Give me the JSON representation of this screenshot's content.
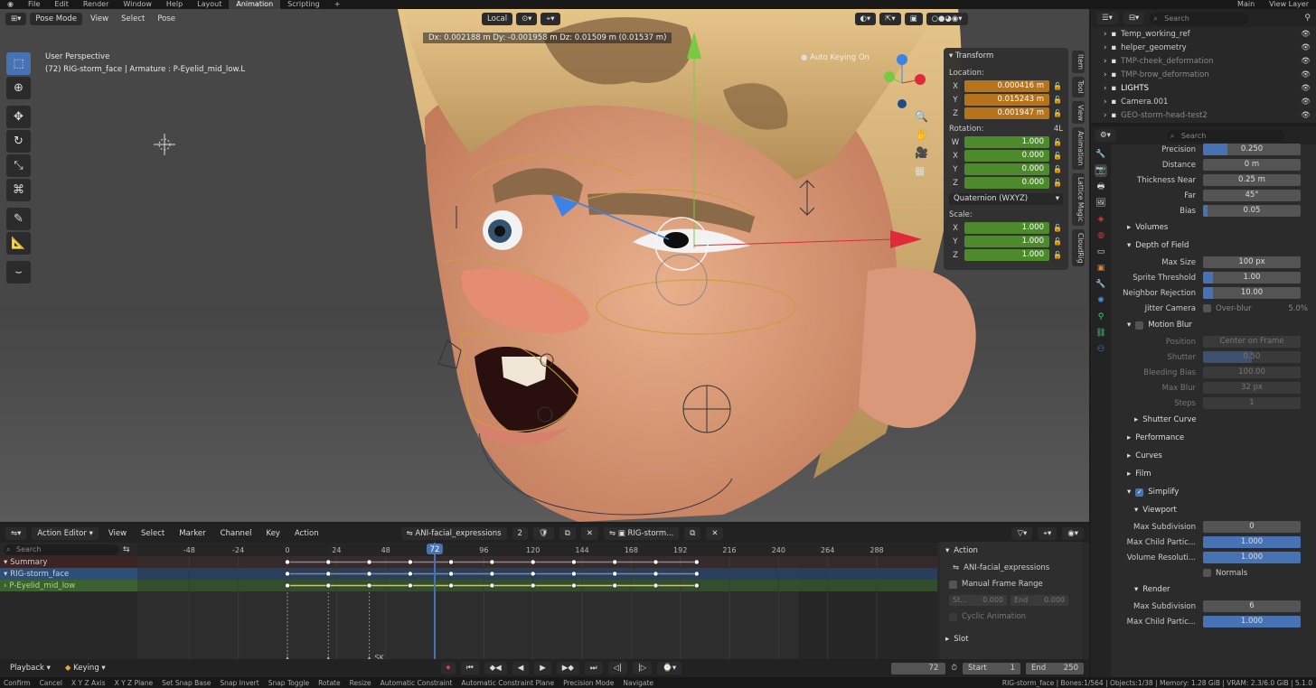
{
  "topbar": {
    "menus": [
      "File",
      "Edit",
      "Render",
      "Window",
      "Help"
    ],
    "workspaces": [
      "Layout",
      "Animation",
      "Scripting"
    ],
    "active_workspace": "Animation",
    "scene": "Main",
    "view_layer": "View Layer"
  },
  "viewport": {
    "mode": "Pose Mode",
    "menus": [
      "View",
      "Select",
      "Pose"
    ],
    "transform_orientation": "Local",
    "perspective": "User Perspective",
    "object_info": "(72) RIG-storm_face | Armature : P-Eyelid_mid_low.L",
    "delta_readout": "Dx: 0.002188 m   Dy: -0.001958 m   Dz: 0.01509 m (0.01537 m)",
    "auto_keying": "Auto Keying On"
  },
  "npanel": {
    "title": "Transform",
    "location_label": "Location:",
    "location": [
      {
        "axis": "X",
        "value": "0.000416 m"
      },
      {
        "axis": "Y",
        "value": "0.015243 m"
      },
      {
        "axis": "Z",
        "value": "0.001947 m"
      }
    ],
    "rotation_label": "Rotation:",
    "rotation_mode_short": "4L",
    "rotation": [
      {
        "axis": "W",
        "value": "1.000"
      },
      {
        "axis": "X",
        "value": "0.000"
      },
      {
        "axis": "Y",
        "value": "0.000"
      },
      {
        "axis": "Z",
        "value": "0.000"
      }
    ],
    "rotation_mode": "Quaternion (WXYZ)",
    "scale_label": "Scale:",
    "scale": [
      {
        "axis": "X",
        "value": "1.000"
      },
      {
        "axis": "Y",
        "value": "1.000"
      },
      {
        "axis": "Z",
        "value": "1.000"
      }
    ],
    "tabs": [
      "Item",
      "Tool",
      "View",
      "Animation",
      "Lattice Magic",
      "CloudRig"
    ]
  },
  "outliner": {
    "search_placeholder": "Search",
    "rows": [
      {
        "name": "Temp_working_ref",
        "color": "#cccccc"
      },
      {
        "name": "helper_geometry",
        "color": "#cccccc"
      },
      {
        "name": "TMP-cheek_deformation",
        "color": "#8a8a8a"
      },
      {
        "name": "TMP-brow_deformation",
        "color": "#8a8a8a"
      },
      {
        "name": "LIGHTS",
        "color": "#ffffff"
      },
      {
        "name": "Camera.001",
        "color": "#cccccc"
      },
      {
        "name": "GEO-storm-head-test2",
        "color": "#8a8a8a"
      }
    ]
  },
  "properties": {
    "search_placeholder": "Search",
    "rows": [
      {
        "kind": "field",
        "label": "Precision",
        "value": "0.250",
        "fill": 0.25
      },
      {
        "kind": "field",
        "label": "Distance",
        "value": "0 m"
      },
      {
        "kind": "field",
        "label": "Thickness Near",
        "value": "0.25 m"
      },
      {
        "kind": "field",
        "label": "Far",
        "value": "45°"
      },
      {
        "kind": "field",
        "label": "Bias",
        "value": "0.05",
        "fill": 0.05
      },
      {
        "kind": "section",
        "label": "Volumes",
        "open": false
      },
      {
        "kind": "section",
        "label": "Depth of Field",
        "open": true
      },
      {
        "kind": "field",
        "label": "Max Size",
        "value": "100 px"
      },
      {
        "kind": "field",
        "label": "Sprite Threshold",
        "value": "1.00",
        "fill": 0.1
      },
      {
        "kind": "field",
        "label": "Neighbor Rejection",
        "value": "10.00",
        "fill": 0.1
      },
      {
        "kind": "check",
        "label": "Jitter Camera",
        "value": "Over-blur",
        "extra": "5.0%"
      },
      {
        "kind": "section",
        "label": "Motion Blur",
        "open": true,
        "checkbox": true
      },
      {
        "kind": "field",
        "label": "Position",
        "value": "Center on Frame",
        "disabled": true
      },
      {
        "kind": "field",
        "label": "Shutter",
        "value": "0.50",
        "disabled": true,
        "fill": 0.5
      },
      {
        "kind": "field",
        "label": "Bleeding Bias",
        "value": "100.00",
        "disabled": true
      },
      {
        "kind": "field",
        "label": "Max Blur",
        "value": "32 px",
        "disabled": true
      },
      {
        "kind": "field",
        "label": "Steps",
        "value": "1",
        "disabled": true
      },
      {
        "kind": "subsection",
        "label": "Shutter Curve",
        "open": false
      },
      {
        "kind": "section",
        "label": "Performance",
        "open": false
      },
      {
        "kind": "section",
        "label": "Curves",
        "open": false
      },
      {
        "kind": "section",
        "label": "Film",
        "open": false
      },
      {
        "kind": "section",
        "label": "Simplify",
        "open": true,
        "checkbox": true,
        "checked": true
      },
      {
        "kind": "subsection",
        "label": "Viewport",
        "open": true
      },
      {
        "kind": "field",
        "label": "Max Subdivision",
        "value": "0"
      },
      {
        "kind": "field",
        "label": "Max Child Partic...",
        "value": "1.000",
        "fill": 1
      },
      {
        "kind": "field",
        "label": "Volume Resoluti...",
        "value": "1.000",
        "fill": 1
      },
      {
        "kind": "check",
        "label": "",
        "value": "Normals"
      },
      {
        "kind": "subsection",
        "label": "Render",
        "open": true
      },
      {
        "kind": "field",
        "label": "Max Subdivision",
        "value": "6"
      },
      {
        "kind": "field",
        "label": "Max Child Partic...",
        "value": "1.000",
        "fill": 1
      }
    ]
  },
  "action_editor": {
    "mode": "Action Editor",
    "menus": [
      "View",
      "Select",
      "Marker",
      "Channel",
      "Key",
      "Action"
    ],
    "action_name": "ANI-facial_expressions",
    "users": "2",
    "slot_name": "RIG-storm...",
    "search_placeholder": "Search",
    "ticks": [
      "-48",
      "-24",
      "0",
      "24",
      "48",
      "72",
      "96",
      "120",
      "144",
      "168",
      "192",
      "216",
      "240",
      "264",
      "288"
    ],
    "current_frame": "72",
    "channels": [
      {
        "name": "Summary",
        "color": "#3a2424"
      },
      {
        "name": "RIG-storm_face",
        "color": "#2c4f7a"
      },
      {
        "name": "P-Eyelid_mid_low",
        "color": "#3c6032"
      }
    ],
    "markers": [
      "Zero",
      "anim",
      "SK"
    ],
    "side": {
      "action_title": "Action",
      "action_name": "ANI-facial_expressions",
      "manual_frame_range": "Manual Frame Range",
      "start_label": "St...",
      "start_value": "0.000",
      "end_label": "End",
      "end_value": "0.000",
      "cyclic": "Cyclic Animation",
      "slot_title": "Slot"
    }
  },
  "playback": {
    "playback_label": "Playback",
    "keying_label": "Keying",
    "frame": "72",
    "start_label": "Start",
    "start_value": "1",
    "end_label": "End",
    "end_value": "250"
  },
  "statusbar": {
    "items": [
      "Confirm",
      "Cancel",
      "X Y Z Axis",
      "X Y Z Plane",
      "Set Snap Base",
      "Snap Invert",
      "Snap Toggle",
      "Rotate",
      "Resize",
      "Automatic Constraint",
      "Automatic Constraint Plane",
      "Precision Mode",
      "Navigate"
    ],
    "info": "RIG-storm_face | Bones:1/564 | Objects:1/38 | Memory: 1.28 GiB | VRAM: 2.3/6.0 GiB | 5.1.0"
  },
  "colors": {
    "accent": "#4772b3",
    "location_field": "#b5741b",
    "rotation_field": "#4c8a2c",
    "playhead": "#4772b3",
    "gizmo_x": "#e02a3c",
    "gizmo_y": "#7ac943",
    "gizmo_z": "#3f82e6"
  }
}
